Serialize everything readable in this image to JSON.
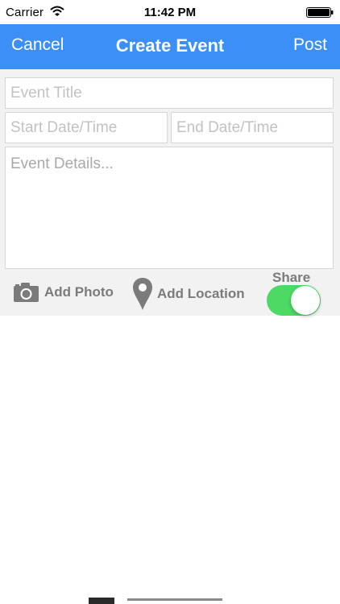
{
  "status_bar": {
    "carrier": "Carrier",
    "time": "11:42 PM"
  },
  "nav": {
    "cancel_label": "Cancel",
    "title": "Create Event",
    "post_label": "Post"
  },
  "form": {
    "title_placeholder": "Event Title",
    "start_placeholder": "Start Date/Time",
    "end_placeholder": "End Date/Time",
    "details_placeholder": "Event Details..."
  },
  "toolbar": {
    "add_photo_label": "Add Photo",
    "add_location_label": "Add Location",
    "share_label": "Share",
    "share_on": true
  },
  "colors": {
    "nav_background": "#3b8ff7",
    "toggle_on": "#4cd964"
  },
  "icons": [
    "wifi-icon",
    "battery-icon",
    "camera-icon",
    "location-pin-icon"
  ]
}
